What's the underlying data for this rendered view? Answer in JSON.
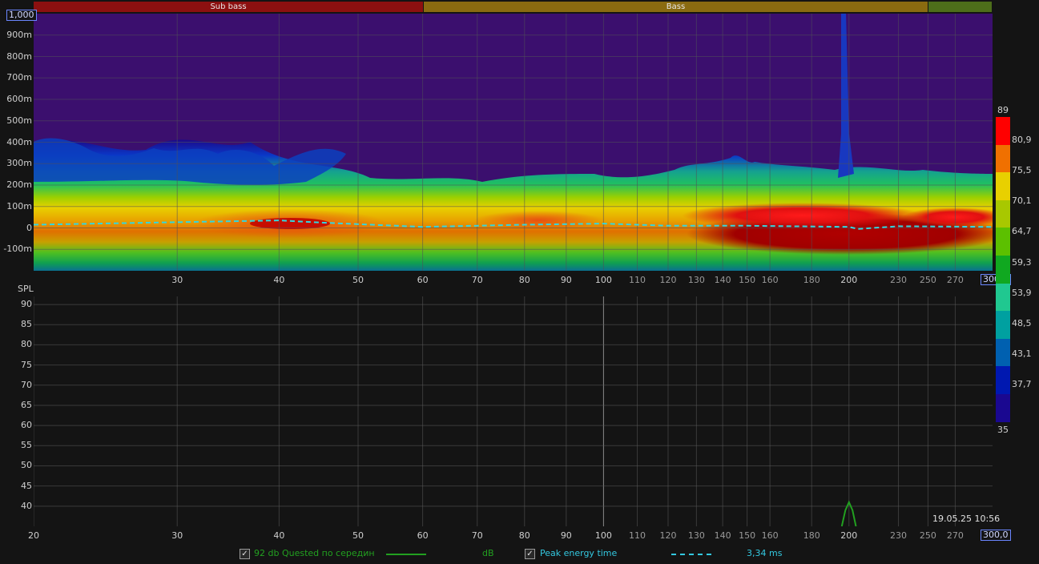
{
  "bands": [
    {
      "label": "Sub bass",
      "color": "#8c1010"
    },
    {
      "label": "Bass",
      "color": "#8a6b10"
    },
    {
      "label": "",
      "color": "#4d6e1a"
    }
  ],
  "spectrogram": {
    "y_top_box": "1,000",
    "y_labels": [
      "900m",
      "800m",
      "700m",
      "600m",
      "500m",
      "400m",
      "300m",
      "200m",
      "100m",
      "0",
      "-100m"
    ],
    "x_labels": [
      "30",
      "40",
      "50",
      "60",
      "70",
      "80",
      "90",
      "100",
      "110",
      "120",
      "130",
      "140",
      "150",
      "160",
      "180",
      "200",
      "230",
      "250",
      "270"
    ],
    "x_end_box": "300,0",
    "colors": {
      "background": "#3b0f6e",
      "peak_line": "#33d6e0"
    }
  },
  "spl_chart": {
    "y_axis_title": "SPL",
    "y_labels": [
      "90",
      "85",
      "80",
      "75",
      "70",
      "65",
      "60",
      "55",
      "50",
      "45",
      "40"
    ],
    "x_labels": [
      "20",
      "30",
      "40",
      "50",
      "60",
      "70",
      "80",
      "90",
      "100",
      "110",
      "120",
      "130",
      "140",
      "150",
      "160",
      "180",
      "200",
      "230",
      "250",
      "270"
    ],
    "x_end_box": "300,0",
    "timestamp": "19.05.25 10:56"
  },
  "colorscale": {
    "top": "89",
    "bottom": "35",
    "labels": [
      "80,9",
      "75,5",
      "70,1",
      "64,7",
      "59,3",
      "53,9",
      "48,5",
      "43,1",
      "37,7"
    ],
    "colors": [
      "#ff0000",
      "#f07000",
      "#e8d000",
      "#a8c800",
      "#5cc000",
      "#10a820",
      "#20c890",
      "#00a0a0",
      "#0060b0",
      "#0018b0",
      "#1a0890"
    ]
  },
  "legend": {
    "item1": {
      "label": "92 db Quested  по середин",
      "unit": "dB",
      "checked": "✓",
      "color": "#22a020"
    },
    "item2": {
      "label": "Peak energy time",
      "value": "3,34 ms",
      "checked": "✓",
      "color": "#33c8e0"
    }
  },
  "chart_data": [
    {
      "type": "heatmap",
      "title": "",
      "xlabel": "",
      "ylabel": "",
      "x_scale": "log",
      "xlim": [
        20,
        300
      ],
      "ylim": [
        -0.2,
        1.0
      ],
      "peak_energy_time_ms": 3.34,
      "peak_line": {
        "x": [
          20,
          40,
          45,
          60,
          80,
          100,
          120,
          150,
          200,
          205,
          230,
          300
        ],
        "y": [
          0.015,
          0.035,
          0.025,
          0.005,
          0.015,
          0.02,
          0.01,
          0.01,
          0.005,
          -0.005,
          0.008,
          0.005
        ]
      }
    },
    {
      "type": "line",
      "title": "",
      "xlabel": "",
      "ylabel": "SPL",
      "x_scale": "log",
      "xlim": [
        20,
        300
      ],
      "ylim": [
        35,
        92
      ],
      "series": [
        {
          "name": "92 db Quested  по середин",
          "x": [
            196,
            198,
            200,
            202,
            204
          ],
          "y": [
            35,
            39,
            41,
            39,
            35
          ]
        }
      ]
    }
  ]
}
